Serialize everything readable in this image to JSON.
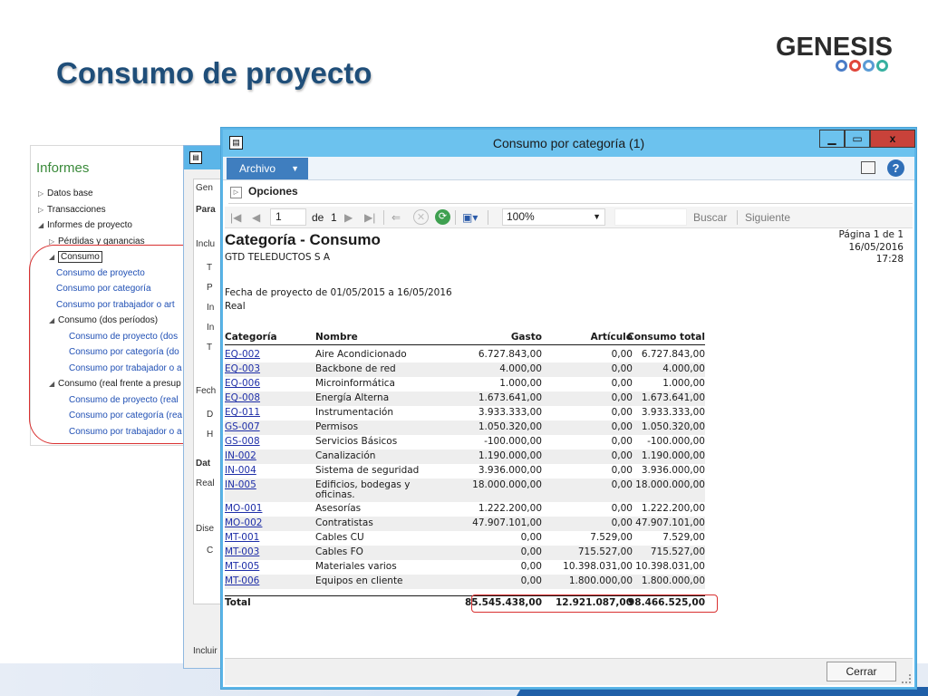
{
  "slide": {
    "title": "Consumo de proyecto",
    "logo_text": "GENESIS",
    "logo_rings": [
      "ring-blue",
      "ring-red",
      "ring-lightblue",
      "ring-teal"
    ]
  },
  "informes": {
    "title": "Informes",
    "items": [
      {
        "arrow": "▷",
        "label": "Datos base",
        "indent": 0,
        "kind": "node"
      },
      {
        "arrow": "▷",
        "label": "Transacciones",
        "indent": 0,
        "kind": "node"
      },
      {
        "arrow": "◢",
        "label": "Informes de proyecto",
        "indent": 0,
        "kind": "node"
      },
      {
        "arrow": "▷",
        "label": "Pérdidas y ganancias",
        "indent": 1,
        "kind": "node"
      },
      {
        "arrow": "◢",
        "label": "Consumo",
        "indent": 1,
        "kind": "boxed"
      },
      {
        "arrow": "",
        "label": "Consumo de proyecto",
        "indent": 2,
        "kind": "link"
      },
      {
        "arrow": "",
        "label": "Consumo por categoría",
        "indent": 2,
        "kind": "link"
      },
      {
        "arrow": "",
        "label": "Consumo por trabajador o art",
        "indent": 2,
        "kind": "link"
      },
      {
        "arrow": "◢",
        "label": "Consumo (dos períodos)",
        "indent": 1,
        "kind": "node"
      },
      {
        "arrow": "",
        "label": "Consumo de proyecto (dos",
        "indent": 3,
        "kind": "link"
      },
      {
        "arrow": "",
        "label": "Consumo por categoría (do",
        "indent": 3,
        "kind": "link"
      },
      {
        "arrow": "",
        "label": "Consumo por trabajador o a",
        "indent": 3,
        "kind": "link"
      },
      {
        "arrow": "◢",
        "label": "Consumo (real frente a presup",
        "indent": 1,
        "kind": "node"
      },
      {
        "arrow": "",
        "label": "Consumo de proyecto (real",
        "indent": 3,
        "kind": "link"
      },
      {
        "arrow": "",
        "label": "Consumo por categoría (rea",
        "indent": 3,
        "kind": "link"
      },
      {
        "arrow": "",
        "label": "Consumo por trabajador o a",
        "indent": 3,
        "kind": "link"
      }
    ]
  },
  "mid_window": {
    "labels": [
      "Gen",
      "Para",
      "Inclu",
      "T",
      "P",
      "In",
      "In",
      "T",
      "Fech",
      "D",
      "H",
      "Dat",
      "Real",
      "Dise",
      "C",
      "Incluir"
    ]
  },
  "window": {
    "title": "Consumo por categoría (1)",
    "min_label": "▁",
    "max_label": "▭",
    "close_label": "x",
    "archivo_label": "Archivo",
    "help_label": "?",
    "opciones_label": "Opciones",
    "toolbar": {
      "page_value": "1",
      "of_label": "de",
      "total_pages": "1",
      "zoom": "100%",
      "buscar": "Buscar",
      "siguiente": "Siguiente"
    },
    "cerrar_label": "Cerrar"
  },
  "report": {
    "title": "Categoría - Consumo",
    "company": "GTD TELEDUCTOS S A",
    "page_info": "Página 1 de 1",
    "date": "16/05/2016",
    "time": "17:28",
    "date_range": "Fecha de proyecto de 01/05/2015 a 16/05/2016",
    "mode": "Real",
    "headers": {
      "categoria": "Categoría",
      "nombre": "Nombre",
      "gasto": "Gasto",
      "articulo": "Artículo",
      "total": "Consumo total"
    },
    "rows": [
      {
        "cat": "EQ-002",
        "nombre": "Aire Acondicionado",
        "gasto": "6.727.843,00",
        "articulo": "0,00",
        "total": "6.727.843,00"
      },
      {
        "cat": "EQ-003",
        "nombre": "Backbone de red",
        "gasto": "4.000,00",
        "articulo": "0,00",
        "total": "4.000,00"
      },
      {
        "cat": "EQ-006",
        "nombre": "Microinformática",
        "gasto": "1.000,00",
        "articulo": "0,00",
        "total": "1.000,00"
      },
      {
        "cat": "EQ-008",
        "nombre": "Energía Alterna",
        "gasto": "1.673.641,00",
        "articulo": "0,00",
        "total": "1.673.641,00"
      },
      {
        "cat": "EQ-011",
        "nombre": "Instrumentación",
        "gasto": "3.933.333,00",
        "articulo": "0,00",
        "total": "3.933.333,00"
      },
      {
        "cat": "GS-007",
        "nombre": "Permisos",
        "gasto": "1.050.320,00",
        "articulo": "0,00",
        "total": "1.050.320,00"
      },
      {
        "cat": "GS-008",
        "nombre": "Servicios Básicos",
        "gasto": "-100.000,00",
        "articulo": "0,00",
        "total": "-100.000,00"
      },
      {
        "cat": "IN-002",
        "nombre": "Canalización",
        "gasto": "1.190.000,00",
        "articulo": "0,00",
        "total": "1.190.000,00"
      },
      {
        "cat": "IN-004",
        "nombre": "Sistema de seguridad",
        "gasto": "3.936.000,00",
        "articulo": "0,00",
        "total": "3.936.000,00"
      },
      {
        "cat": "IN-005",
        "nombre": "Edificios, bodegas y",
        "nombre2": "oficinas.",
        "gasto": "18.000.000,00",
        "articulo": "0,00",
        "total": "18.000.000,00"
      },
      {
        "cat": "MO-001",
        "nombre": "Asesorías",
        "gasto": "1.222.200,00",
        "articulo": "0,00",
        "total": "1.222.200,00"
      },
      {
        "cat": "MO-002",
        "nombre": "Contratistas",
        "gasto": "47.907.101,00",
        "articulo": "0,00",
        "total": "47.907.101,00"
      },
      {
        "cat": "MT-001",
        "nombre": "Cables CU",
        "gasto": "0,00",
        "articulo": "7.529,00",
        "total": "7.529,00"
      },
      {
        "cat": "MT-003",
        "nombre": "Cables FO",
        "gasto": "0,00",
        "articulo": "715.527,00",
        "total": "715.527,00"
      },
      {
        "cat": "MT-005",
        "nombre": "Materiales varios",
        "gasto": "0,00",
        "articulo": "10.398.031,00",
        "total": "10.398.031,00"
      },
      {
        "cat": "MT-006",
        "nombre": "Equipos en cliente",
        "gasto": "0,00",
        "articulo": "1.800.000,00",
        "total": "1.800.000,00"
      }
    ],
    "total": {
      "label": "Total",
      "gasto": "85.545.438,00",
      "articulo": "12.921.087,00",
      "total": "98.466.525,00"
    }
  },
  "colors": {
    "title_blue": "#1f4e79",
    "window_border": "#5bb5e8",
    "highlight_red": "#d93030",
    "link_blue": "#1f2fa8"
  }
}
